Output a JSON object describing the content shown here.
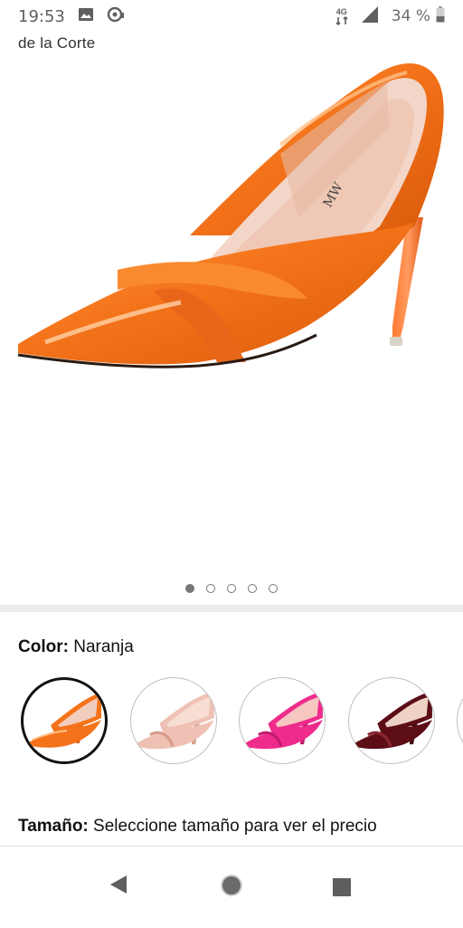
{
  "status_bar": {
    "time": "19:53",
    "network": "4G",
    "battery": "34 %",
    "icons": [
      "image-icon",
      "sync-icon",
      "network-4g-icon",
      "signal-icon",
      "battery-icon"
    ]
  },
  "product": {
    "subtitle": "de la Corte",
    "image_color": "#f4731a",
    "carousel": {
      "total": 5,
      "active_index": 0
    }
  },
  "color_selector": {
    "label": "Color:",
    "value": "Naranja",
    "swatches": [
      {
        "color": "#f4731a",
        "selected": true
      },
      {
        "color": "#efc1b4",
        "selected": false
      },
      {
        "color": "#ef2c8c",
        "selected": false
      },
      {
        "color": "#5c0d16",
        "selected": false
      },
      {
        "color": "#7a7a7a",
        "selected": false
      }
    ]
  },
  "size_selector": {
    "label": "Tamaño:",
    "value": "Seleccione tamaño para ver el precio"
  },
  "nav": {
    "icons": [
      "back-icon",
      "home-icon",
      "recents-icon"
    ]
  }
}
